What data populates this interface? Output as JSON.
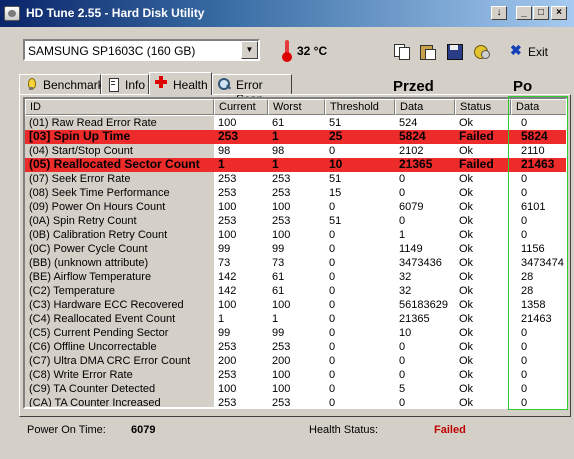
{
  "window": {
    "title": "HD Tune 2.55 - Hard Disk Utility",
    "controls": [
      "↓",
      "_",
      "□",
      "×"
    ]
  },
  "toolbar": {
    "drive": "SAMSUNG SP1603C (160 GB)",
    "temperature": "32 °C",
    "exit_label": "Exit",
    "icons": [
      "copy-icon",
      "paste-icon",
      "save-icon",
      "options-icon",
      "exit-icon"
    ]
  },
  "annotations": {
    "before": "Przed",
    "after": "Po"
  },
  "tabs": [
    {
      "label": "Benchmark",
      "icon": "benchmark-icon"
    },
    {
      "label": "Info",
      "icon": "info-icon"
    },
    {
      "label": "Health",
      "icon": "health-icon",
      "active": true
    },
    {
      "label": "Error Scan",
      "icon": "error-scan-icon"
    }
  ],
  "table": {
    "columns": [
      "ID",
      "Current",
      "Worst",
      "Threshold",
      "Data",
      "Status",
      "Data"
    ],
    "rows": [
      {
        "id": "(01) Raw Read Error Rate",
        "current": "100",
        "worst": "61",
        "threshold": "51",
        "data": "524",
        "status": "Ok",
        "after": "0"
      },
      {
        "id": "[03] Spin Up Time",
        "current": "253",
        "worst": "1",
        "threshold": "25",
        "data": "5824",
        "status": "Failed",
        "after": "5824",
        "failed": true
      },
      {
        "id": "(04) Start/Stop Count",
        "current": "98",
        "worst": "98",
        "threshold": "0",
        "data": "2102",
        "status": "Ok",
        "after": "2110"
      },
      {
        "id": "(05) Reallocated Sector Count",
        "current": "1",
        "worst": "1",
        "threshold": "10",
        "data": "21365",
        "status": "Failed",
        "after": "21463",
        "failed": true
      },
      {
        "id": "(07) Seek Error Rate",
        "current": "253",
        "worst": "253",
        "threshold": "51",
        "data": "0",
        "status": "Ok",
        "after": "0"
      },
      {
        "id": "(08) Seek Time Performance",
        "current": "253",
        "worst": "253",
        "threshold": "15",
        "data": "0",
        "status": "Ok",
        "after": "0"
      },
      {
        "id": "(09) Power On Hours Count",
        "current": "100",
        "worst": "100",
        "threshold": "0",
        "data": "6079",
        "status": "Ok",
        "after": "6101"
      },
      {
        "id": "(0A) Spin Retry Count",
        "current": "253",
        "worst": "253",
        "threshold": "51",
        "data": "0",
        "status": "Ok",
        "after": "0"
      },
      {
        "id": "(0B) Calibration Retry Count",
        "current": "100",
        "worst": "100",
        "threshold": "0",
        "data": "1",
        "status": "Ok",
        "after": "0"
      },
      {
        "id": "(0C) Power Cycle Count",
        "current": "99",
        "worst": "99",
        "threshold": "0",
        "data": "1149",
        "status": "Ok",
        "after": "1156"
      },
      {
        "id": "(BB) (unknown attribute)",
        "current": "73",
        "worst": "73",
        "threshold": "0",
        "data": "3473436",
        "status": "Ok",
        "after": "3473474"
      },
      {
        "id": "(BE) Airflow Temperature",
        "current": "142",
        "worst": "61",
        "threshold": "0",
        "data": "32",
        "status": "Ok",
        "after": "28"
      },
      {
        "id": "(C2) Temperature",
        "current": "142",
        "worst": "61",
        "threshold": "0",
        "data": "32",
        "status": "Ok",
        "after": "28"
      },
      {
        "id": "(C3) Hardware ECC Recovered",
        "current": "100",
        "worst": "100",
        "threshold": "0",
        "data": "56183629",
        "status": "Ok",
        "after": "1358"
      },
      {
        "id": "(C4) Reallocated Event Count",
        "current": "1",
        "worst": "1",
        "threshold": "0",
        "data": "21365",
        "status": "Ok",
        "after": "21463"
      },
      {
        "id": "(C5) Current Pending Sector",
        "current": "99",
        "worst": "99",
        "threshold": "0",
        "data": "10",
        "status": "Ok",
        "after": "0"
      },
      {
        "id": "(C6) Offline Uncorrectable",
        "current": "253",
        "worst": "253",
        "threshold": "0",
        "data": "0",
        "status": "Ok",
        "after": "0"
      },
      {
        "id": "(C7) Ultra DMA CRC Error Count",
        "current": "200",
        "worst": "200",
        "threshold": "0",
        "data": "0",
        "status": "Ok",
        "after": "0"
      },
      {
        "id": "(C8) Write Error Rate",
        "current": "253",
        "worst": "100",
        "threshold": "0",
        "data": "0",
        "status": "Ok",
        "after": "0"
      },
      {
        "id": "(C9) TA Counter Detected",
        "current": "100",
        "worst": "100",
        "threshold": "0",
        "data": "5",
        "status": "Ok",
        "after": "0"
      },
      {
        "id": "(CA) TA Counter Increased",
        "current": "253",
        "worst": "253",
        "threshold": "0",
        "data": "0",
        "status": "Ok",
        "after": "0"
      }
    ]
  },
  "status": {
    "power_on_label": "Power On Time:",
    "power_on_value": "6079",
    "health_label": "Health Status:",
    "health_value": "Failed"
  },
  "colors": {
    "failed_row": "#ee2b2b",
    "failed_text": "#c00000",
    "highlight_box": "#2ecc2e",
    "titlebar": "#0a246a"
  }
}
